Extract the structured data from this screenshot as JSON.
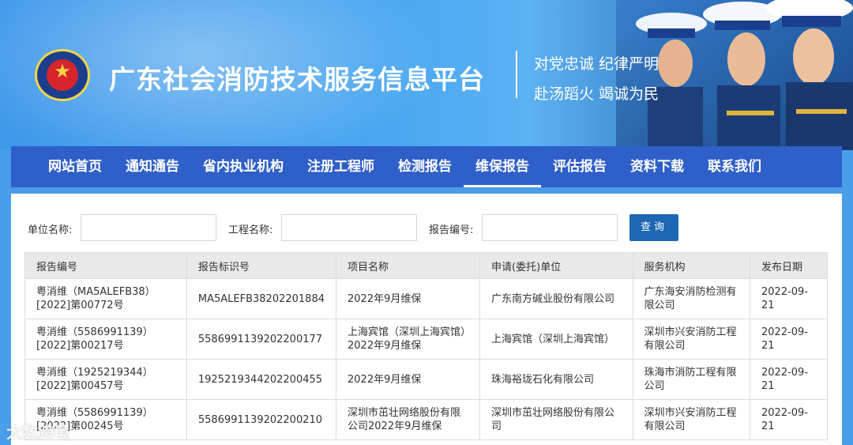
{
  "header": {
    "title": "广东社会消防技术服务信息平台",
    "slogan_line1": "对党忠诚 纪律严明",
    "slogan_line2": "赴汤蹈火 竭诚为民"
  },
  "nav": {
    "items": [
      {
        "label": "网站首页",
        "active": false
      },
      {
        "label": "通知通告",
        "active": false
      },
      {
        "label": "省内执业机构",
        "active": false
      },
      {
        "label": "注册工程师",
        "active": false
      },
      {
        "label": "检测报告",
        "active": false
      },
      {
        "label": "维保报告",
        "active": true
      },
      {
        "label": "评估报告",
        "active": false
      },
      {
        "label": "资料下载",
        "active": false
      },
      {
        "label": "联系我们",
        "active": false
      }
    ]
  },
  "search": {
    "unit_label": "单位名称:",
    "unit_value": "",
    "project_label": "工程名称:",
    "project_value": "",
    "report_label": "报告编号:",
    "report_value": "",
    "button_label": "查询"
  },
  "table": {
    "headers": [
      "报告编号",
      "报告标识号",
      "项目名称",
      "申请(委托)单位",
      "服务机构",
      "发布日期"
    ],
    "rows": [
      [
        "粤消维（MA5ALEFB38）[2022]第00772号",
        "MA5ALEFB38202201884",
        "2022年9月维保",
        "广东南方碱业股份有限公司",
        "广东海安消防检测有限公司",
        "2022-09-21"
      ],
      [
        "粤消维（5586991139）[2022]第00217号",
        "5586991139202200177",
        "上海宾馆（深圳上海宾馆）2022年9月维保",
        "上海宾馆（深圳上海宾馆）",
        "深圳市兴安消防工程有限公司",
        "2022-09-21"
      ],
      [
        "粤消维（1925219344）[2022]第00457号",
        "1925219344202200455",
        "2022年9月维保",
        "珠海裕珑石化有限公司",
        "珠海市消防工程有限公司",
        "2022-09-21"
      ],
      [
        "粤消维（5586991139）[2022]第00245号",
        "5586991139202200210",
        "深圳市茁壮网络股份有限公司2022年9月维保",
        "深圳市茁壮网络股份有限公司",
        "深圳市兴安消防工程有限公司",
        "2022-09-21"
      ]
    ]
  },
  "watermark": "大数跨境",
  "colors": {
    "nav_bg": "#2f5fc8",
    "button_bg": "#1d67b3",
    "header_bg": "#49a6f0"
  }
}
